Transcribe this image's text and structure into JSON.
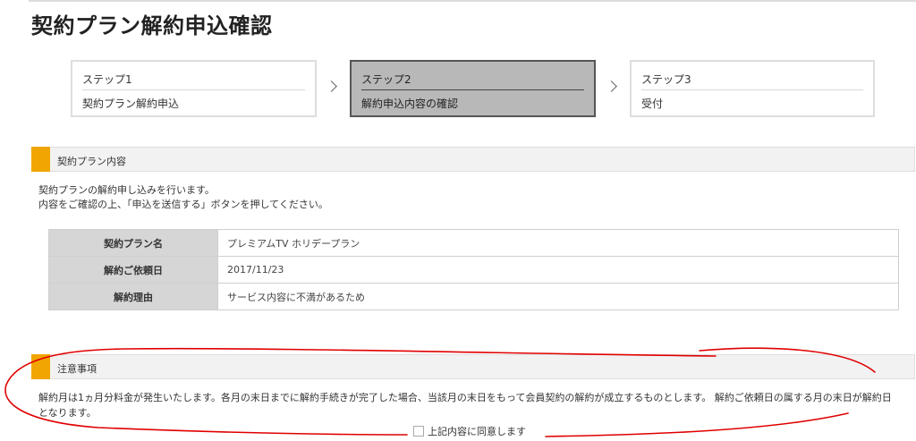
{
  "page": {
    "title": "契約プラン解約申込確認"
  },
  "steps": [
    {
      "num": "ステップ1",
      "label": "契約プラン解約申込"
    },
    {
      "num": "ステップ2",
      "label": "解約申込内容の確認"
    },
    {
      "num": "ステップ3",
      "label": "受付"
    }
  ],
  "plan_section": {
    "header": "契約プラン内容",
    "desc_line1": "契約プランの解約申し込みを行います。",
    "desc_line2": "内容をご確認の上、「申込を送信する」ボタンを押してください。",
    "rows": [
      {
        "label": "契約プラン名",
        "value": "プレミアムTV ホリデープラン"
      },
      {
        "label": "解約ご依頼日",
        "value": "2017/11/23"
      },
      {
        "label": "解約理由",
        "value": "サービス内容に不満があるため"
      }
    ]
  },
  "notice_section": {
    "header": "注意事項",
    "text": "解約月は1ヵ月分料金が発生いたします。各月の末日までに解約手続きが完了した場合、当該月の末日をもって会員契約の解約が成立するものとします。 解約ご依頼日の属する月の末日が解約日となります。",
    "agree_label": "上記内容に同意します"
  },
  "colors": {
    "accent": "#f0a500",
    "annotation": "#e00000"
  }
}
